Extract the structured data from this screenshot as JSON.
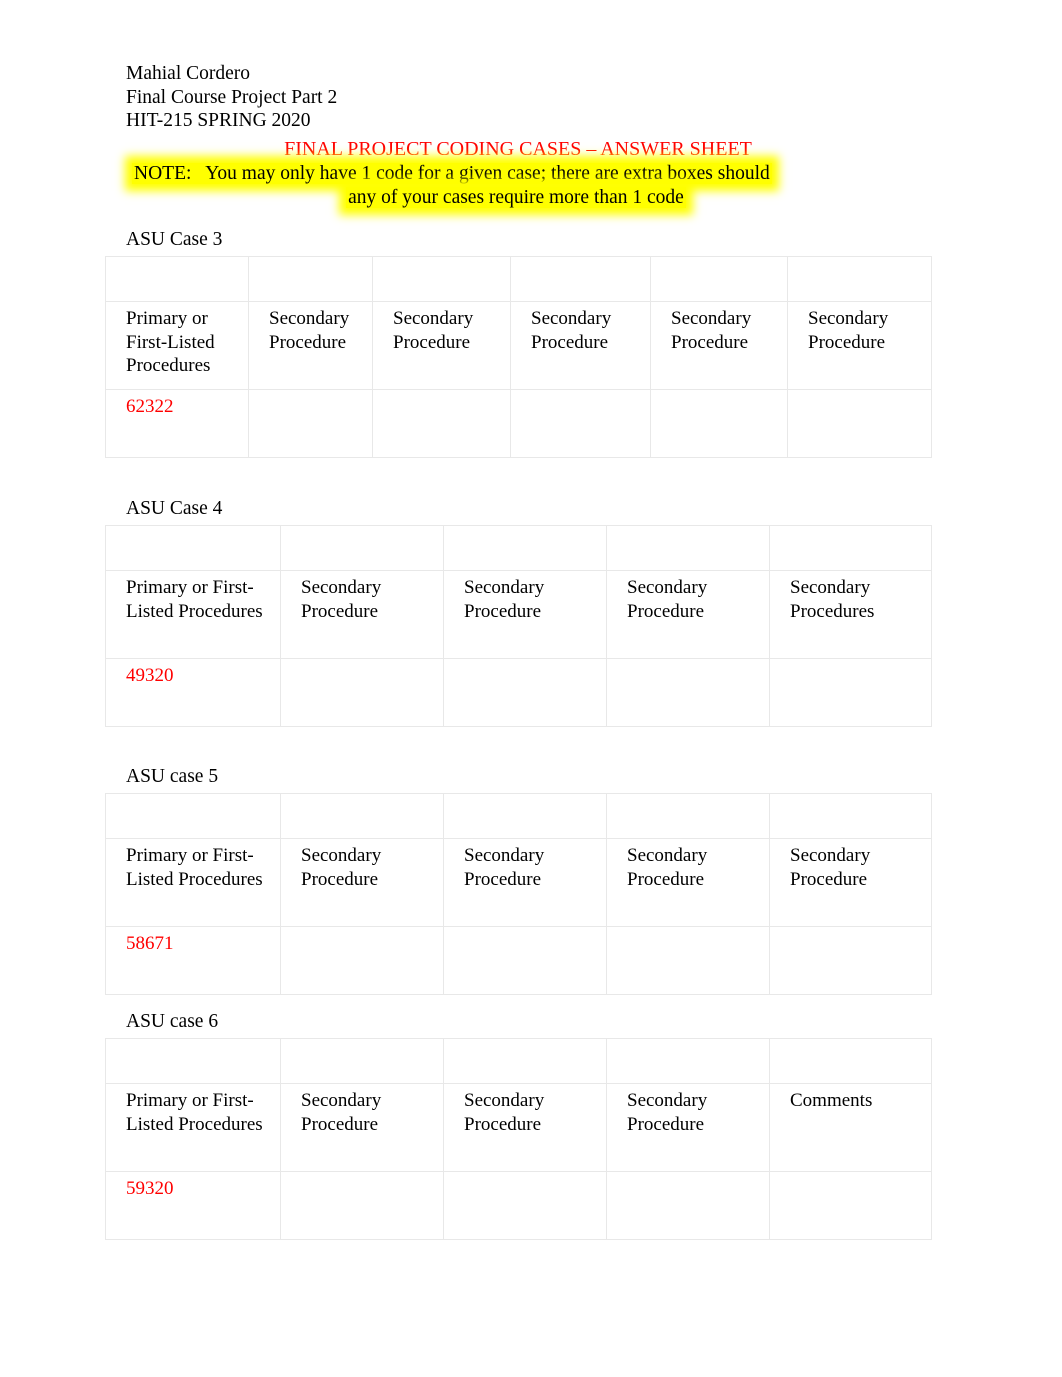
{
  "header": {
    "author": "Mahial Cordero",
    "assignment": "Final Course Project Part 2",
    "course": "HIT-215 SPRING 2020",
    "title": "FINAL PROJECT CODING CASES – ANSWER SHEET",
    "note_line_1": "NOTE:   You may only have 1 code for a given case; there are extra boxes should",
    "note_line_2": "any of your cases require more than 1 code",
    "title_color": "#ff0000",
    "highlight_color": "#ffff00"
  },
  "code_color": "#ff0000",
  "cases": [
    {
      "label": "ASU Case 3",
      "columns": [
        "Primary or First-Listed Procedures",
        "Secondary Procedure",
        "Secondary Procedure",
        "Secondary Procedure",
        "Secondary Procedure",
        "Secondary Procedure"
      ],
      "values": [
        "62322",
        "",
        "",
        "",
        "",
        ""
      ]
    },
    {
      "label": "ASU Case 4",
      "columns": [
        "Primary or First-Listed Procedures",
        "Secondary Procedure",
        "Secondary Procedure",
        "Secondary Procedure",
        "Secondary Procedures"
      ],
      "values": [
        "49320",
        "",
        "",
        "",
        ""
      ]
    },
    {
      "label": "ASU case 5",
      "columns": [
        "Primary or First-Listed Procedures",
        "Secondary Procedure",
        "Secondary Procedure",
        "Secondary Procedure",
        "Secondary Procedure"
      ],
      "values": [
        "58671",
        "",
        "",
        "",
        ""
      ]
    },
    {
      "label": "ASU case 6",
      "columns": [
        "Primary or First-Listed Procedures",
        "Secondary Procedure",
        "Secondary Procedure",
        "Secondary Procedure",
        "Comments"
      ],
      "values": [
        "59320",
        "",
        "",
        "",
        ""
      ]
    }
  ]
}
